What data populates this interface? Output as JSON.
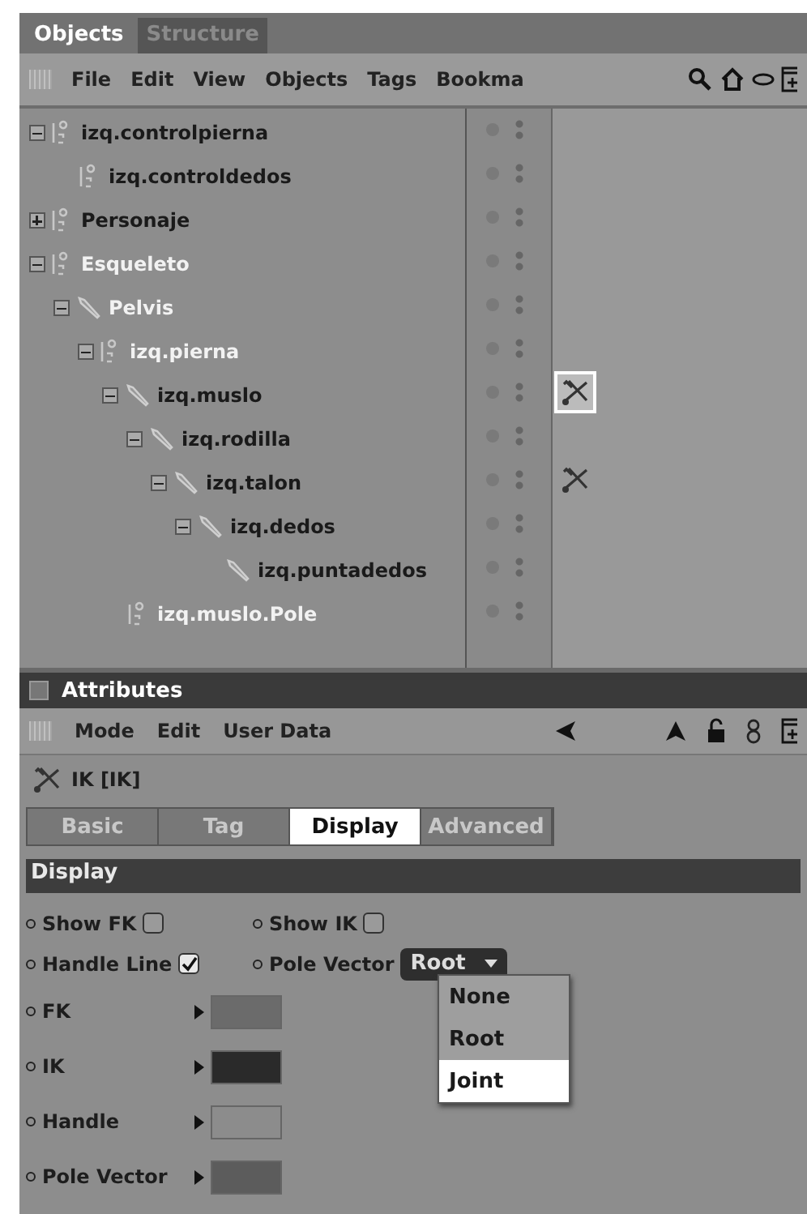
{
  "objects_panel": {
    "tabs": [
      {
        "label": "Objects",
        "selected": true
      },
      {
        "label": "Structure",
        "selected": false
      }
    ],
    "menu": [
      "File",
      "Edit",
      "View",
      "Objects",
      "Tags",
      "Bookma"
    ],
    "tree": [
      {
        "name": "izq.controlpierna",
        "kind": "null",
        "selected": false,
        "expanded": true,
        "children": [
          {
            "name": "izq.controldedos",
            "kind": "null",
            "selected": false
          }
        ]
      },
      {
        "name": "Personaje",
        "kind": "null",
        "selected": false,
        "expanded": false
      },
      {
        "name": "Esqueleto",
        "kind": "null",
        "selected": true,
        "expanded": true,
        "children": [
          {
            "name": "Pelvis",
            "kind": "bone",
            "selected": true,
            "expanded": true,
            "children": [
              {
                "name": "izq.pierna",
                "kind": "null",
                "selected": true,
                "expanded": true,
                "children": [
                  {
                    "name": "izq.muslo",
                    "kind": "bone",
                    "selected": false,
                    "expanded": true,
                    "tag": {
                      "selected": true
                    },
                    "children": [
                      {
                        "name": "izq.rodilla",
                        "kind": "bone",
                        "selected": false,
                        "expanded": true,
                        "children": [
                          {
                            "name": "izq.talon",
                            "kind": "bone",
                            "selected": false,
                            "expanded": true,
                            "tag": {
                              "selected": false
                            },
                            "children": [
                              {
                                "name": "izq.dedos",
                                "kind": "bone",
                                "selected": false,
                                "expanded": true,
                                "children": [
                                  {
                                    "name": "izq.puntadedos",
                                    "kind": "bone",
                                    "selected": false
                                  }
                                ]
                              }
                            ]
                          }
                        ]
                      }
                    ]
                  },
                  {
                    "name": "izq.muslo.Pole",
                    "kind": "null",
                    "selected": true
                  }
                ]
              }
            ]
          }
        ]
      }
    ]
  },
  "attributes_panel": {
    "title": "Attributes",
    "menu": [
      "Mode",
      "Edit",
      "User Data"
    ],
    "object_label": "IK [IK]",
    "tabs": [
      {
        "label": "Basic",
        "selected": false
      },
      {
        "label": "Tag",
        "selected": false
      },
      {
        "label": "Display",
        "selected": true
      },
      {
        "label": "Advanced",
        "selected": false
      }
    ],
    "section": "Display",
    "checkboxes": [
      {
        "label": "Show FK",
        "checked": false
      },
      {
        "label": "Show IK",
        "checked": false
      },
      {
        "label": "Handle Line",
        "checked": true
      }
    ],
    "pole_vector": {
      "label": "Pole Vector",
      "value": "Root",
      "options": [
        {
          "label": "None",
          "highlighted": false
        },
        {
          "label": "Root",
          "highlighted": false
        },
        {
          "label": "Joint",
          "highlighted": true
        }
      ]
    },
    "colors": [
      {
        "label": "FK",
        "color": "#6b6b6b"
      },
      {
        "label": "IK",
        "color": "#2a2a2a"
      },
      {
        "label": "Handle",
        "color": "#8c8c8c"
      },
      {
        "label": "Pole Vector",
        "color": "#5c5c5c"
      }
    ]
  }
}
